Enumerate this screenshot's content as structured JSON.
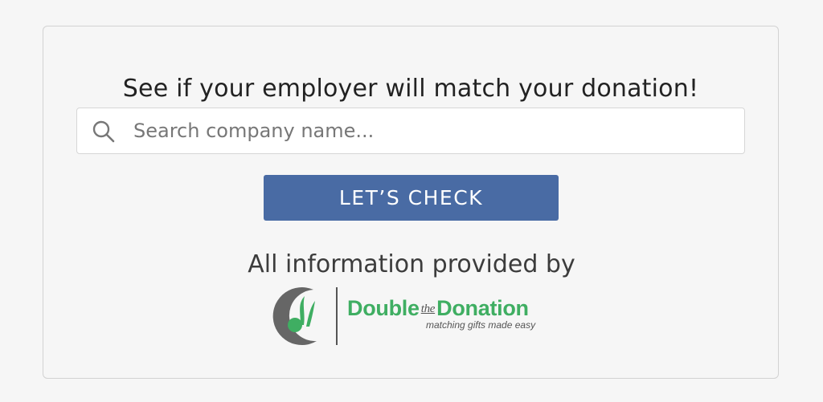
{
  "widget": {
    "heading": "See if your employer will match your donation!",
    "search": {
      "placeholder": "Search company name...",
      "value": ""
    },
    "check_button_label": "LET’S CHECK",
    "provided_by": "All information provided by",
    "logo": {
      "name_part1": "Double",
      "name_part2": "the",
      "name_part3": "Donation",
      "tagline": "matching gifts made easy",
      "colors": {
        "brand_green": "#3fae62",
        "mark_gray": "#666666"
      }
    },
    "colors": {
      "button": "#496ba4",
      "background": "#f6f6f6",
      "border": "#d2d2d2"
    }
  }
}
